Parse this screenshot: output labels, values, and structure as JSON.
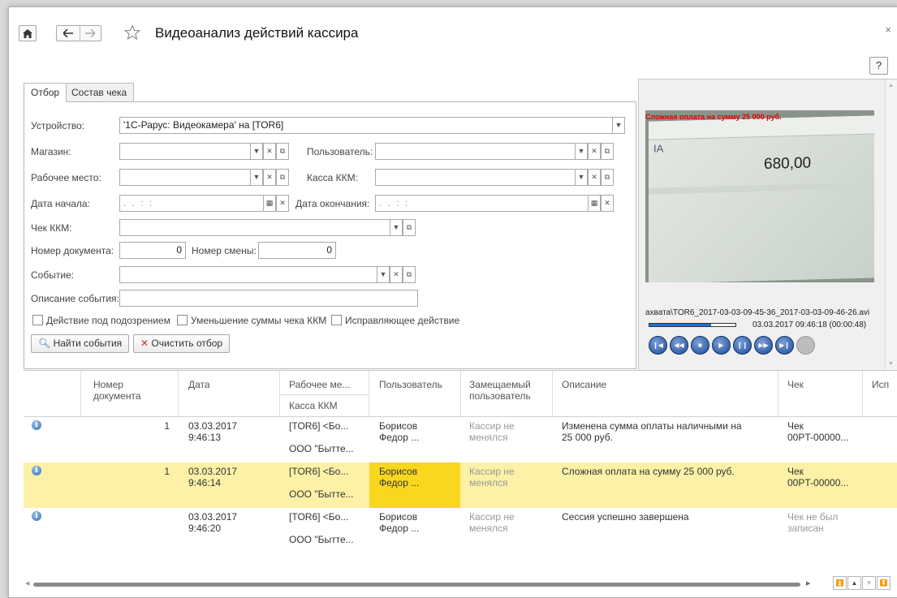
{
  "window": {
    "title": "Видеоанализ действий кассира",
    "help_label": "?",
    "close_label": "×"
  },
  "tabs": [
    {
      "label": "Отбор",
      "active": true
    },
    {
      "label": "Состав чека",
      "active": false
    }
  ],
  "filters": {
    "device_label": "Устройство:",
    "device_value": "'1С-Рарус: Видеокамера' на [TOR6]",
    "store_label": "Магазин:",
    "user_label": "Пользователь:",
    "workplace_label": "Рабочее место:",
    "register_label": "Касса ККМ:",
    "date_start_label": "Дата начала:",
    "date_start_placeholder": ". .   : :",
    "date_end_label": "Дата окончания:",
    "date_end_placeholder": ". .   : :",
    "receipt_label": "Чек ККМ:",
    "doc_number_label": "Номер документа:",
    "doc_number_value": "0",
    "shift_number_label": "Номер смены:",
    "shift_number_value": "0",
    "event_label": "Событие:",
    "event_description_label": "Описание события:",
    "checkboxes": [
      {
        "label": "Действие под подозрением",
        "checked": false
      },
      {
        "label": "Уменьшение суммы чека ККМ",
        "checked": false
      },
      {
        "label": "Исправляющее действие",
        "checked": false
      }
    ],
    "find_button": "Найти события",
    "clear_button": "Очистить отбор"
  },
  "video": {
    "overlay_text": "Сложная оплата на сумму 25 000 руб.",
    "screen_amount": "680,00",
    "screen_letters": "IA",
    "file_path": "ахвата\\TOR6_2017-03-03-09-45-36_2017-03-03-09-46-26.avi",
    "timestamp": "03.03.2017 09:46:18 (00:00:48)",
    "progress": 0.72,
    "controls": [
      "prev-icon",
      "rewind-icon",
      "stop-icon",
      "play-icon",
      "pause-icon",
      "forward-icon",
      "next-icon",
      "record-icon"
    ]
  },
  "table": {
    "headers": {
      "doc_number": "Номер документа",
      "date": "Дата",
      "workplace": "Рабочее ме...",
      "register": "Касса ККМ",
      "user": "Пользователь",
      "replaced_user": "Замещаемый пользователь",
      "description": "Описание",
      "receipt": "Чек",
      "extra": "Исп"
    },
    "rows": [
      {
        "number": "1",
        "date": "03.03.2017",
        "time": "9:46:13",
        "workplace": "[TOR6] <Бо...",
        "register": "ООО \"Бытте...",
        "user1": "Борисов",
        "user2": "Федор ...",
        "replaced1": "Кассир не",
        "replaced2": "менялся",
        "description1": "Изменена сумма оплаты наличными на",
        "description2": "25 000 руб.",
        "receipt1": "Чек",
        "receipt2": "00PT-00000...",
        "selected": false
      },
      {
        "number": "1",
        "date": "03.03.2017",
        "time": "9:46:14",
        "workplace": "[TOR6] <Бо...",
        "register": "ООО \"Бытте...",
        "user1": "Борисов",
        "user2": "Федор ...",
        "replaced1": "Кассир не",
        "replaced2": "менялся",
        "description1": "Сложная оплата на сумму 25 000 руб.",
        "description2": "",
        "receipt1": "Чек",
        "receipt2": "00PT-00000...",
        "selected": true
      },
      {
        "number": "",
        "date": "03.03.2017",
        "time": "9:46:20",
        "workplace": "[TOR6] <Бо...",
        "register": "ООО \"Бытте...",
        "user1": "Борисов",
        "user2": "Федор ...",
        "replaced1": "Кассир не",
        "replaced2": "менялся",
        "description1": "Сессия успешно завершена",
        "description2": "",
        "receipt1": "Чек не был",
        "receipt2": "записан",
        "selected": false
      }
    ]
  },
  "colors": {
    "selected_row": "#fcf1a6",
    "selected_cell": "#f9d71e",
    "accent_blue": "#1c4a9a"
  }
}
